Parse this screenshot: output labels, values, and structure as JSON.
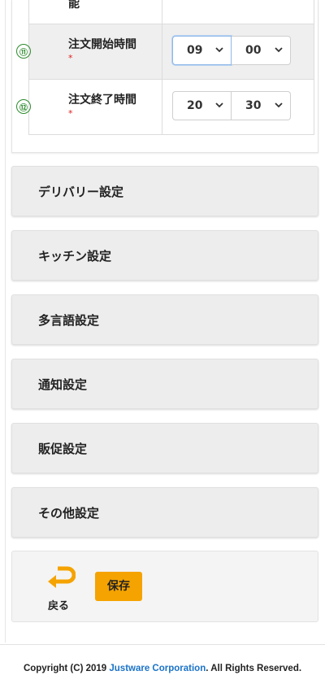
{
  "table": {
    "rows": [
      {
        "label": "能",
        "marker": "",
        "required": "",
        "hour": "",
        "minute": ""
      },
      {
        "label": "注文開始時間",
        "marker": "⑪",
        "required": "*",
        "hour": "09",
        "minute": "00"
      },
      {
        "label": "注文終了時間",
        "marker": "⑫",
        "required": "*",
        "hour": "20",
        "minute": "30"
      }
    ]
  },
  "sections": [
    {
      "label": "デリバリー設定"
    },
    {
      "label": "キッチン設定"
    },
    {
      "label": "多言語設定"
    },
    {
      "label": "通知設定"
    },
    {
      "label": "販促設定"
    },
    {
      "label": "その他設定"
    }
  ],
  "actions": {
    "back_label": "戻る",
    "save_label": "保存",
    "back_icon": "return-arrow-icon",
    "accent_color": "#f5a300"
  },
  "footer": {
    "prefix": "Copyright (C) 2019 ",
    "company": "Justware Corporation",
    "suffix": ". All Rights Reserved."
  },
  "colors": {
    "marker": "#2e8b2e",
    "required": "#e02020",
    "link": "#1a73c8",
    "save_button": "#f5a300"
  }
}
